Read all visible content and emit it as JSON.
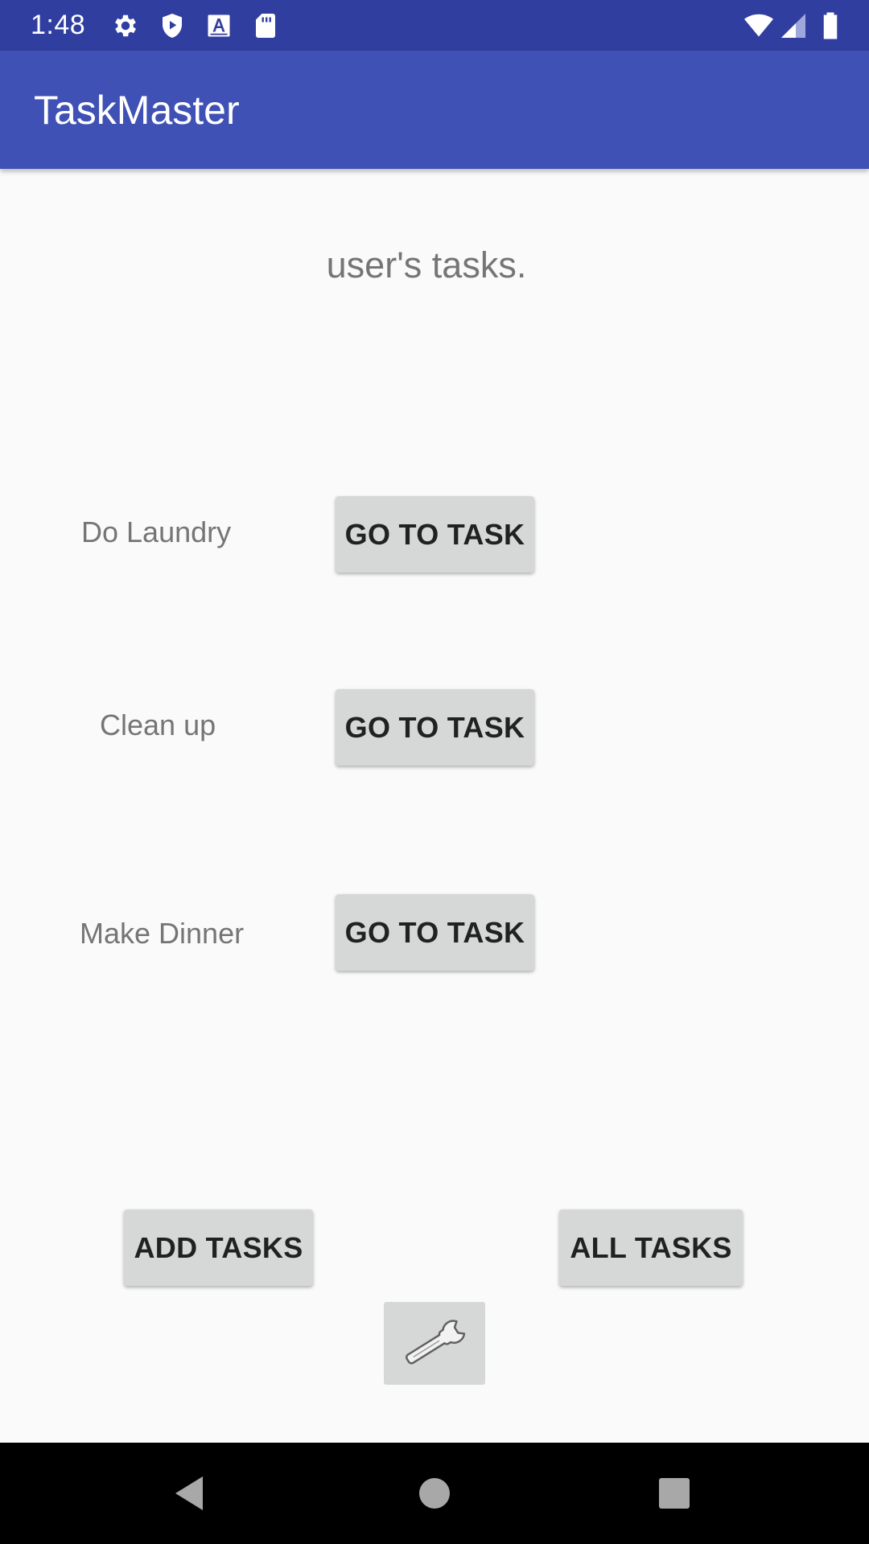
{
  "status_bar": {
    "time": "1:48",
    "left_icons": [
      "settings-gear-icon",
      "shield-play-icon",
      "text-a-icon",
      "sd-card-icon"
    ],
    "right_icons": [
      "wifi-icon",
      "cellular-signal-icon",
      "battery-icon"
    ]
  },
  "app_bar": {
    "title": "TaskMaster"
  },
  "main": {
    "subtitle": "user's tasks.",
    "tasks": [
      {
        "label": "Do Laundry",
        "button_label": "GO TO TASK"
      },
      {
        "label": "Clean up",
        "button_label": "GO TO TASK"
      },
      {
        "label": "Make Dinner",
        "button_label": "GO TO TASK"
      }
    ],
    "add_tasks_label": "ADD TASKS",
    "all_tasks_label": "ALL TASKS",
    "settings_button_icon": "wrench-icon"
  },
  "nav_bar": {
    "icons": [
      "back-icon",
      "home-icon",
      "recents-icon"
    ]
  },
  "colors": {
    "status_bar": "#303f9f",
    "app_bar": "#3f51b5",
    "background": "#fafafa",
    "button": "#d6d7d7",
    "label_text": "#757575"
  }
}
